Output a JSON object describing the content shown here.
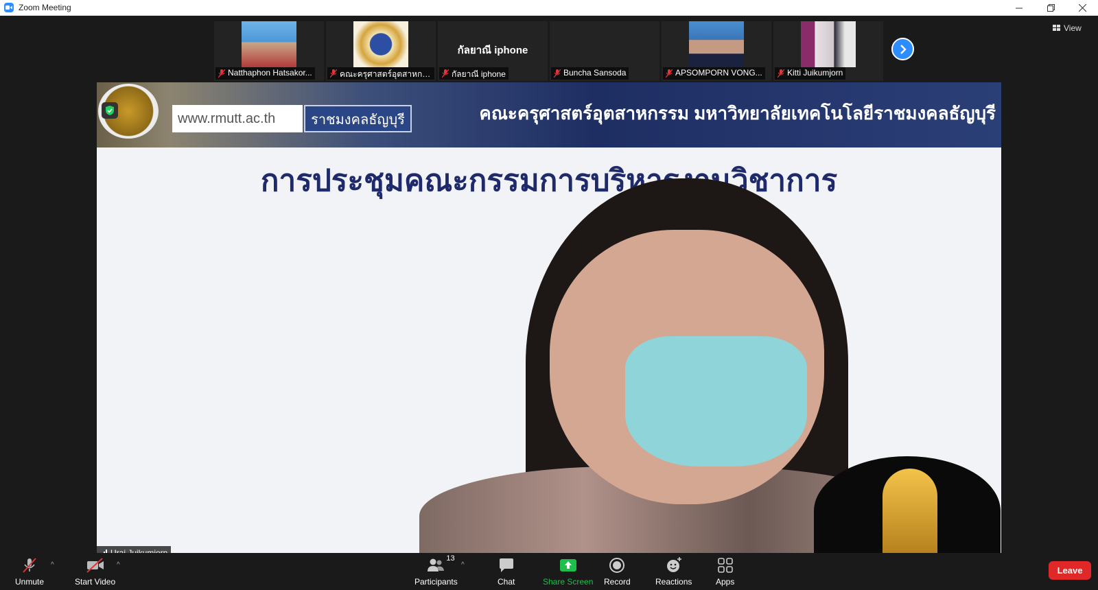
{
  "window": {
    "title": "Zoom Meeting"
  },
  "view_button": {
    "label": "View"
  },
  "participants_strip": [
    {
      "name": "Natthaphon Hatsakor...",
      "big_name": "",
      "has_photo": true,
      "photo_color": "#2f7cc0"
    },
    {
      "name": "คณะครุศาสตร์อุตสาหกรร...",
      "big_name": "",
      "has_photo": true,
      "photo_color": "#d5a43d"
    },
    {
      "name": "กัลยาณี iphone",
      "big_name": "กัลยาณี iphone",
      "has_photo": false,
      "photo_color": ""
    },
    {
      "name": "Buncha Sansoda",
      "big_name": "",
      "has_photo": false,
      "photo_color": ""
    },
    {
      "name": "APSOMPORN VONG...",
      "big_name": "",
      "has_photo": true,
      "photo_color": "#3b76b6"
    },
    {
      "name": "Kitti Juikumjorn",
      "big_name": "",
      "has_photo": true,
      "photo_color": "#7d6b8c"
    }
  ],
  "main_video": {
    "banner_url": "www.rmutt.ac.th",
    "banner_url2": "ราชมงคลธัญบุรี",
    "banner_faculty": "คณะครุศาสตร์อุตสาหกรรม มหาวิทยาลัยเทคโนโลยีราชมงคลธัญบุรี",
    "slide_title": "การประชุมคณะกรรมการบริหารงานวิชาการ",
    "speaker_name": "Urai Juikumjorn"
  },
  "toolbar": {
    "unmute": "Unmute",
    "start_video": "Start Video",
    "participants": "Participants",
    "participants_count": "13",
    "chat": "Chat",
    "share_screen": "Share Screen",
    "record": "Record",
    "reactions": "Reactions",
    "apps": "Apps",
    "leave": "Leave"
  },
  "colors": {
    "accent_blue": "#2d8cff",
    "share_green": "#1fbf4c",
    "leave_red": "#e02828",
    "muted_red": "#e0353b"
  }
}
